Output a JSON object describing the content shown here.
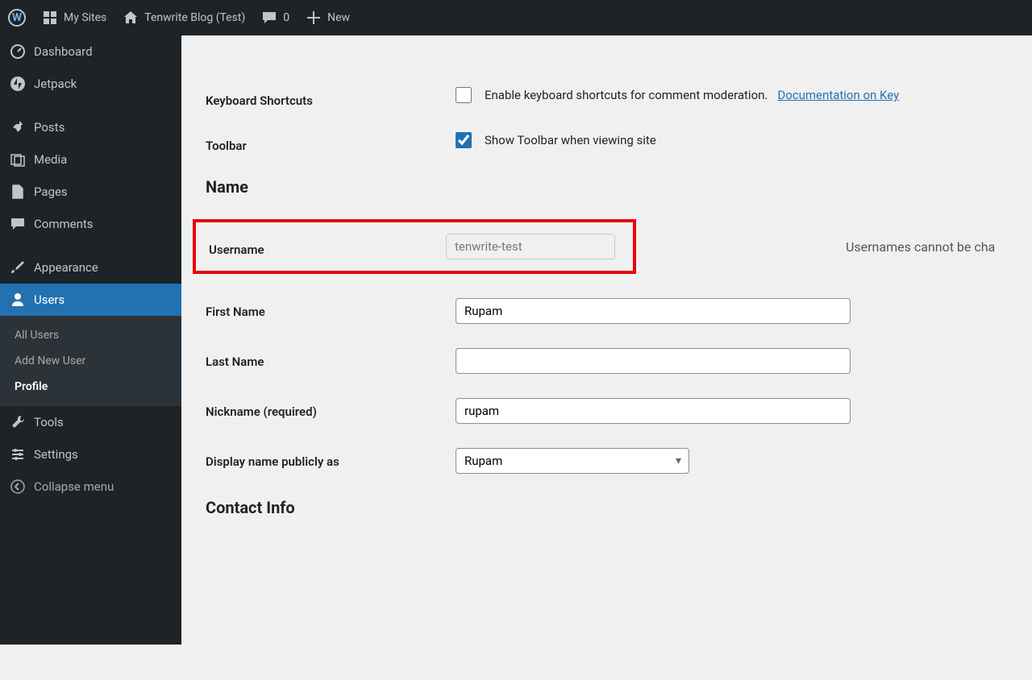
{
  "toolbar": {
    "my_sites": "My Sites",
    "site_title": "Tenwrite Blog (Test)",
    "comments_count": "0",
    "new_label": "New"
  },
  "sidebar": {
    "dashboard": "Dashboard",
    "jetpack": "Jetpack",
    "posts": "Posts",
    "media": "Media",
    "pages": "Pages",
    "comments": "Comments",
    "appearance": "Appearance",
    "users": "Users",
    "submenu": {
      "all_users": "All Users",
      "add_new": "Add New User",
      "profile": "Profile"
    },
    "tools": "Tools",
    "settings": "Settings",
    "collapse": "Collapse menu"
  },
  "form": {
    "keyboard_shortcuts_label": "Keyboard Shortcuts",
    "keyboard_shortcuts_text": "Enable keyboard shortcuts for comment moderation.",
    "keyboard_shortcuts_link": "Documentation on Key",
    "toolbar_label": "Toolbar",
    "toolbar_text": "Show Toolbar when viewing site",
    "name_heading": "Name",
    "username_label": "Username",
    "username_value": "tenwrite-test",
    "username_note": "Usernames cannot be cha",
    "first_name_label": "First Name",
    "first_name_value": "Rupam",
    "last_name_label": "Last Name",
    "last_name_value": "",
    "nickname_label": "Nickname (required)",
    "nickname_value": "rupam",
    "display_name_label": "Display name publicly as",
    "display_name_value": "Rupam",
    "contact_heading": "Contact Info"
  }
}
